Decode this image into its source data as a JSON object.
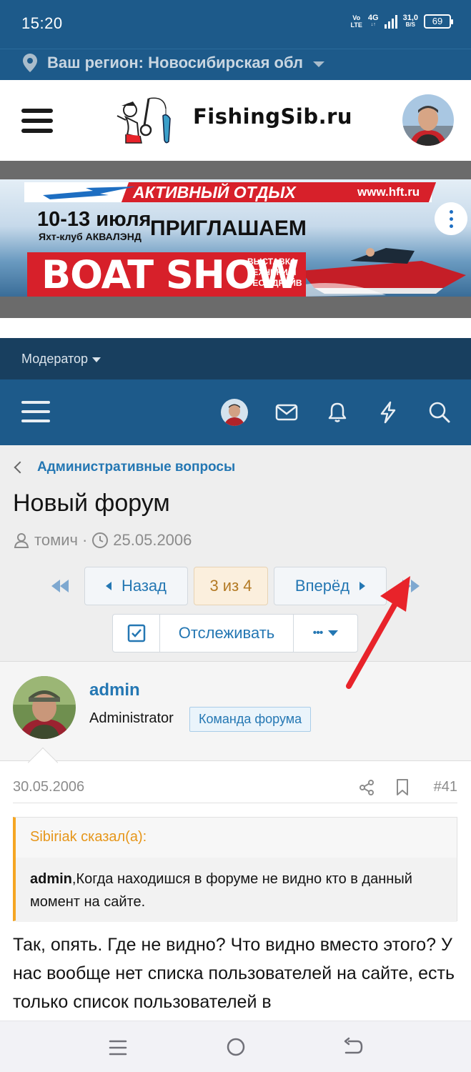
{
  "status": {
    "time": "15:20",
    "volte_line1": "Vo",
    "volte_line2": "LTE",
    "network": "4G",
    "speed_value": "31,0",
    "speed_unit": "B/S",
    "battery": "69"
  },
  "region": {
    "label": "Ваш регион: Новосибирская обл"
  },
  "site": {
    "logo_text": "FishingSib.ru"
  },
  "ad": {
    "headline": "АКТИВНЫЙ ОТДЫХ",
    "url": "www.hft.ru",
    "dates": "10-13 июля",
    "venue": "Яхт-клуб АКВАЛЭНД",
    "invite": "ПРИГЛАШАЕМ",
    "event": "BOAT SHOW",
    "details_line1": "ВЫСТАВКА",
    "details_line2": "ТЕХНИКИ И",
    "details_line3": "ТЕСТ-ДРАЙВ"
  },
  "moderator": {
    "label": "Модератор"
  },
  "thread": {
    "breadcrumb": "Административные вопросы",
    "title": "Новый форум",
    "author": "томич",
    "separator": "·",
    "date": "25.05.2006"
  },
  "pagination": {
    "prev_label": "Назад",
    "current": "3 из 4",
    "next_label": "Вперёд"
  },
  "tools": {
    "watch_label": "Отслеживать",
    "more_label": "•••"
  },
  "post": {
    "username": "admin",
    "role": "Administrator",
    "badge": "Команда форума",
    "date": "30.05.2006",
    "number": "#41",
    "quote_author": "Sibiriak сказал(а):",
    "quote_bold": "admin",
    "quote_text": ",Когда находишся в форуме не видно кто в данный момент на сайте.",
    "body": "Так, опять. Где не видно? Что видно вместо этого? У нас вообще нет списка пользователей на сайте, есть только список пользователей в"
  },
  "colors": {
    "brand_blue": "#1d5a8a",
    "link_blue": "#2477b3",
    "quote_accent": "#f5a623",
    "annotation_red": "#e8232a"
  }
}
